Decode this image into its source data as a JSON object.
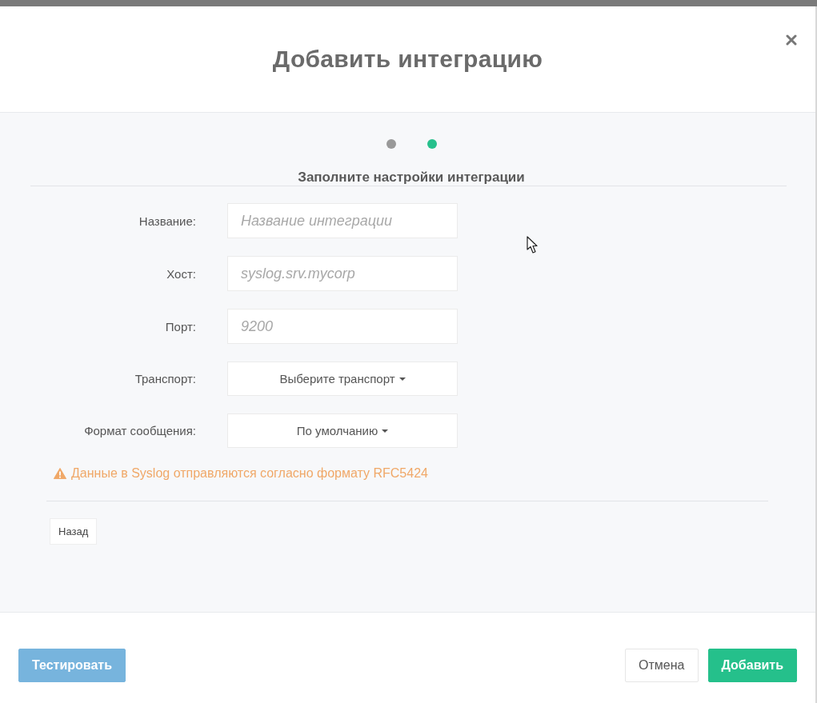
{
  "dialog": {
    "title": "Добавить интеграцию"
  },
  "steps": [
    {
      "selected": false
    },
    {
      "selected": true
    }
  ],
  "subtitle": "Заполните настройки интеграции",
  "fields": [
    {
      "kind": "text",
      "label": "Название:",
      "placeholder": "Название интеграции"
    },
    {
      "kind": "text",
      "label": "Хост:",
      "placeholder": "syslog.srv.mycorp"
    },
    {
      "kind": "text",
      "label": "Порт:",
      "placeholder": "9200"
    },
    {
      "kind": "select",
      "label": "Транспорт:",
      "value": "Выберите транспорт"
    },
    {
      "kind": "select",
      "label": "Формат сообщения:",
      "value": "По умолчанию"
    }
  ],
  "warning": "Данные в Syslog отправляются согласно формату RFC5424",
  "back_button": "Назад",
  "footer": {
    "left_buttons": [
      {
        "kind": "info",
        "label": "Тестировать"
      }
    ],
    "right_buttons": [
      {
        "kind": "default",
        "label": "Отмена"
      },
      {
        "kind": "primary",
        "label": "Добавить"
      }
    ]
  }
}
